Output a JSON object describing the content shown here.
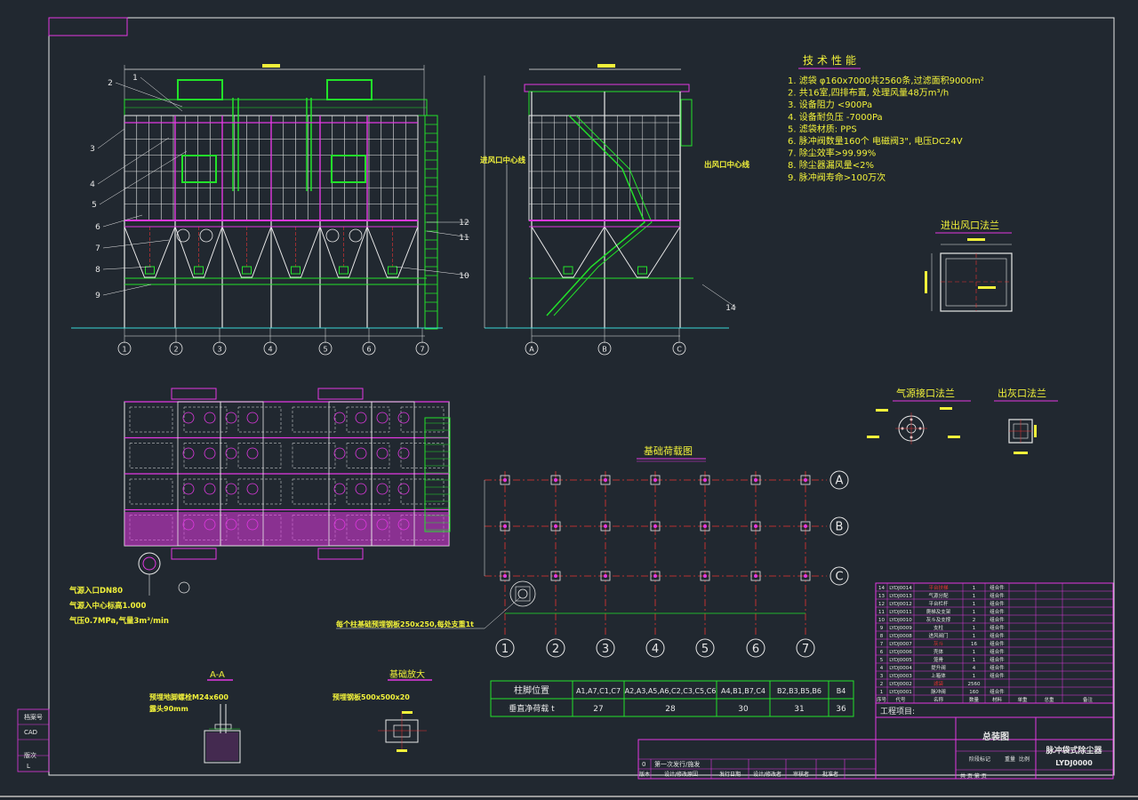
{
  "colors": {
    "background": "#212830",
    "white": "#e8e8e8",
    "green": "#22e22a",
    "magenta": "#e238e2",
    "yellow": "#f2f23a",
    "red": "#e83232",
    "cyan": "#39d9d9"
  },
  "tech": {
    "title": "技术性能",
    "items": [
      "1. 滤袋 φ160x7000共2560条,过滤面积9000m²",
      "2. 共16室,四排布置, 处理风量48万m³/h",
      "3. 设备阻力 <900Pa",
      "4. 设备耐负压 -7000Pa",
      "5. 滤袋材质: PPS",
      "6. 脉冲阀数量160个 电磁阀3\", 电压DC24V",
      "7. 除尘效率>99.99%",
      "8. 除尘器漏风量<2%",
      "9. 脉冲阀寿命>100万次"
    ]
  },
  "views": {
    "inlet_center": "进风口中心线",
    "outlet_center": "出风口中心线",
    "flange_title": "进出风口法兰",
    "air_flange_title": "气源接口法兰",
    "ash_flange_title": "出灰口法兰",
    "load_title": "基础荷载图",
    "section_aa": "A-A",
    "foundation_detail": "基础放大",
    "air_note_1": "气源入口DN80",
    "air_note_2": "气源入中心标高1.000",
    "air_note_3": "气压0.7MPa,气量3m³/min",
    "embed_note": "每个柱基础预埋钢板250x250,每处支重1t",
    "embed_note_aa": "预埋地脚螺栓M24x600",
    "embed_note_aa2": "露头90mm",
    "embed_note_fd": "预埋钢板500x500x20"
  },
  "front_axes": [
    "1",
    "2",
    "3",
    "4",
    "5",
    "6",
    "7"
  ],
  "side_axes": [
    "A",
    "B",
    "C"
  ],
  "part_callouts": [
    "1",
    "2",
    "3",
    "4",
    "5",
    "6",
    "7",
    "8",
    "9",
    "10",
    "11",
    "12",
    "14"
  ],
  "load_rows": [
    "A",
    "B",
    "C"
  ],
  "load_cols": [
    "1",
    "2",
    "3",
    "4",
    "5",
    "6",
    "7"
  ],
  "load_table": {
    "headers": [
      "柱脚位置",
      "A1,A7,C1,C7",
      "A2,A3,A5,A6,C2,C3,C5,C6",
      "A4,B1,B7,C4",
      "B2,B3,B5,B6",
      "B4"
    ],
    "row_label": "垂直净荷载 t",
    "values": [
      "27",
      "28",
      "30",
      "31",
      "36"
    ]
  },
  "title_block": {
    "project_label": "工程项目:",
    "drawing_name": "总装图",
    "product_name": "脉冲袋式除尘器",
    "drawing_no": "LYDJ0000",
    "revision_note": "第一次发行/施发",
    "revision_row": "0",
    "labels": [
      "版本",
      "设计/修改原因",
      "发行日期",
      "设计/修改者",
      "审核者",
      "批准者"
    ],
    "stage_label": "阶段标记",
    "weight_label": "重量",
    "scale_label": "比例",
    "sheet_label": "共   页 第   页",
    "left_labels": [
      "档案号",
      "CAD",
      "版次"
    ],
    "left_values": [
      "",
      "",
      "L"
    ]
  },
  "bom": {
    "headers": [
      "序号",
      "代号",
      "名称",
      "数量",
      "材料",
      "单重",
      "总重",
      "备注"
    ],
    "rows": [
      [
        "14",
        "LYDJ0014",
        "平台扶梯",
        "1",
        "组合件"
      ],
      [
        "13",
        "LYDJ0013",
        "气源分配",
        "1",
        "组合件"
      ],
      [
        "12",
        "LYDJ0012",
        "平台栏杆",
        "1",
        "组合件"
      ],
      [
        "11",
        "LYDJ0011",
        "爬梯及支架",
        "1",
        "组合件"
      ],
      [
        "10",
        "LYDJ0010",
        "灰斗及支撑",
        "2",
        "组合件"
      ],
      [
        "9",
        "LYDJ0009",
        "支柱",
        "1",
        "组合件"
      ],
      [
        "8",
        "LYDJ0008",
        "进风阀门",
        "1",
        "组合件"
      ],
      [
        "7",
        "LYDJ0007",
        "灰斗",
        "16",
        "组合件"
      ],
      [
        "6",
        "LYDJ0006",
        "壳体",
        "1",
        "组合件"
      ],
      [
        "5",
        "LYDJ0005",
        "笼骨",
        "1",
        "组合件"
      ],
      [
        "4",
        "LYDJ0004",
        "提升阀",
        "4",
        "组合件"
      ],
      [
        "3",
        "LYDJ0003",
        "上箱体",
        "1",
        "组合件"
      ],
      [
        "2",
        "LYDJ0002",
        "滤袋",
        "2560",
        "",
        ""
      ],
      [
        "1",
        "LYDJ0001",
        "脉冲阀",
        "160",
        "组合件"
      ]
    ]
  }
}
